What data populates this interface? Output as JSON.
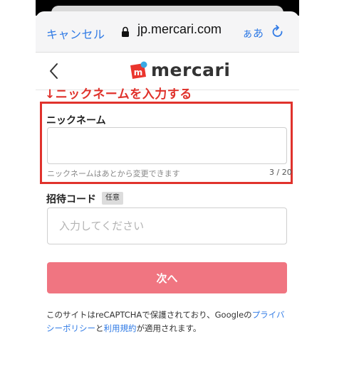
{
  "browser": {
    "cancel_label": "キャンセル",
    "url": "jp.mercari.com",
    "text_size_label": "ぁあ",
    "reload_icon": "reload-icon",
    "lock_icon": "lock-icon"
  },
  "header": {
    "logo_text": "mercari",
    "back_icon": "chevron-left-icon"
  },
  "annotation": {
    "text": "↓ニックネームを入力する",
    "color": "#e0322c"
  },
  "form": {
    "nickname": {
      "label": "ニックネーム",
      "value": "",
      "placeholder": "",
      "hint": "ニックネームはあとから変更できます",
      "counter": "3 / 20"
    },
    "invite": {
      "label": "招待コード",
      "badge": "任意",
      "value": "",
      "placeholder": "入力してください"
    },
    "next_label": "次へ"
  },
  "notice": {
    "text_before": "このサイトはreCAPTCHAで保護されており、Googleの",
    "privacy_link": "プライバシーポリシー",
    "text_middle": "と",
    "terms_link": "利用規約",
    "text_after": "が適用されます。"
  },
  "colors": {
    "link": "#2f7ae5",
    "button": "#f07581",
    "highlight": "#e0322c"
  }
}
